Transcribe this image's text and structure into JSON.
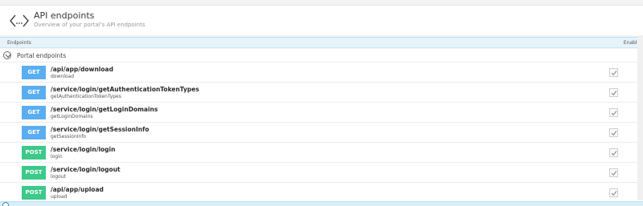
{
  "header": {
    "title": "API endpoints",
    "subtitle": "Overview of your portal's API endpoints",
    "icon": "code-brackets-icon"
  },
  "table": {
    "col_endpoints": "Endpoints",
    "col_enabled": "Enabled"
  },
  "group": {
    "label": "Portal endpoints",
    "toggle_icon": "chevron-down-circle-icon"
  },
  "endpoints": [
    {
      "method": "GET",
      "path": "/api/app/download",
      "name": "download",
      "enabled": true
    },
    {
      "method": "GET",
      "path": "/service/login/getAuthenticationTokenTypes",
      "name": "getAuthenticationTokenTypes",
      "enabled": true
    },
    {
      "method": "GET",
      "path": "/service/login/getLoginDomains",
      "name": "getLoginDomains",
      "enabled": true
    },
    {
      "method": "GET",
      "path": "/service/login/getSessionInfo",
      "name": "getSessionInfo",
      "enabled": true
    },
    {
      "method": "POST",
      "path": "/service/login/login",
      "name": "login",
      "enabled": true
    },
    {
      "method": "POST",
      "path": "/service/login/logout",
      "name": "logout",
      "enabled": true
    },
    {
      "method": "POST",
      "path": "/api/app/upload",
      "name": "upload",
      "enabled": true
    }
  ],
  "colors": {
    "get": "#5aaef0",
    "post": "#3cc98a",
    "table_header_bg": "#e6f4fa"
  }
}
